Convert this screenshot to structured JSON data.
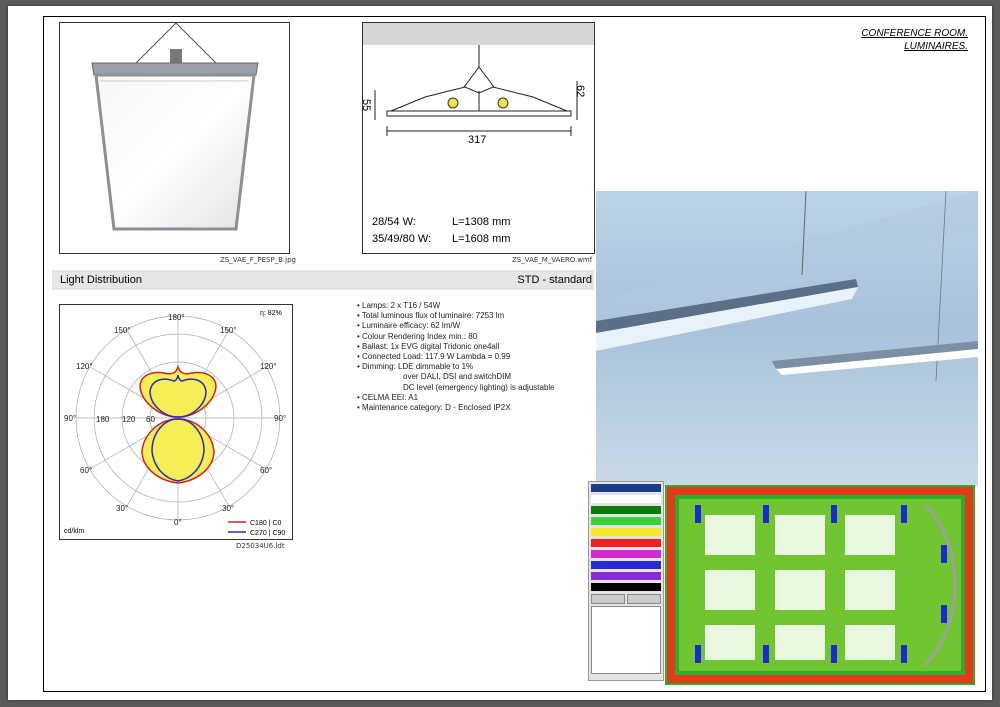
{
  "header": {
    "line1": "CONFERENCE ROOM.",
    "line2": "LUMINAIRES."
  },
  "product_photo": {
    "caption": "ZS_VAE_F_PESP_B.jpg"
  },
  "dimension_drawing": {
    "caption": "ZS_VAE_M_VAERO.wmf",
    "dim_left": "55",
    "dim_right": "62",
    "dim_width": "317",
    "row1_watt": "28/54 W:",
    "row1_len": "L=1308 mm",
    "row2_watt": "35/49/80 W:",
    "row2_len": "L=1608 mm"
  },
  "light_distribution": {
    "title": "Light Distribution",
    "variant": "STD - standard",
    "efficiency": "η:  82%",
    "unit": "cd/klm",
    "file": "D25034U6.ldt",
    "legend_c0": "C180 | C0",
    "legend_c90": "C270 | C90",
    "angles": {
      "a180": "180°",
      "a150l": "150°",
      "a150r": "150°",
      "a120l": "120°",
      "a120r": "120°",
      "a90l": "90°",
      "a90r": "90°",
      "a60l": "60°",
      "a60r": "60°",
      "a30l": "30°",
      "a30r": "30°",
      "a0": "0°"
    },
    "scale": {
      "s180": "180",
      "s120": "120",
      "s60": "60"
    }
  },
  "specs": [
    "• Lamps: 2 x T16 / 54W",
    "• Total luminous flux of luminaire: 7253 lm",
    "• Luminaire efficacy: 62 lm/W",
    "• Colour Rendering Index min.: 80",
    "• Ballast: 1x EVG digital Tridonic one4all",
    "• Connected Load: 117.9 W Lambda = 0.99",
    "• Dimming: LDE dimmable to 1%",
    "over DALI, DSI and switchDIM",
    "DC level (emergency lighting) is adjustable",
    "• CELMA EEI: A1",
    "• Maintenance category: D - Enclosed IP2X"
  ],
  "colors": {
    "c0_curve": "#d42020",
    "c90_curve": "#2a2ab8",
    "fill": "#f5ee55",
    "bar": "#e6e6e6"
  }
}
